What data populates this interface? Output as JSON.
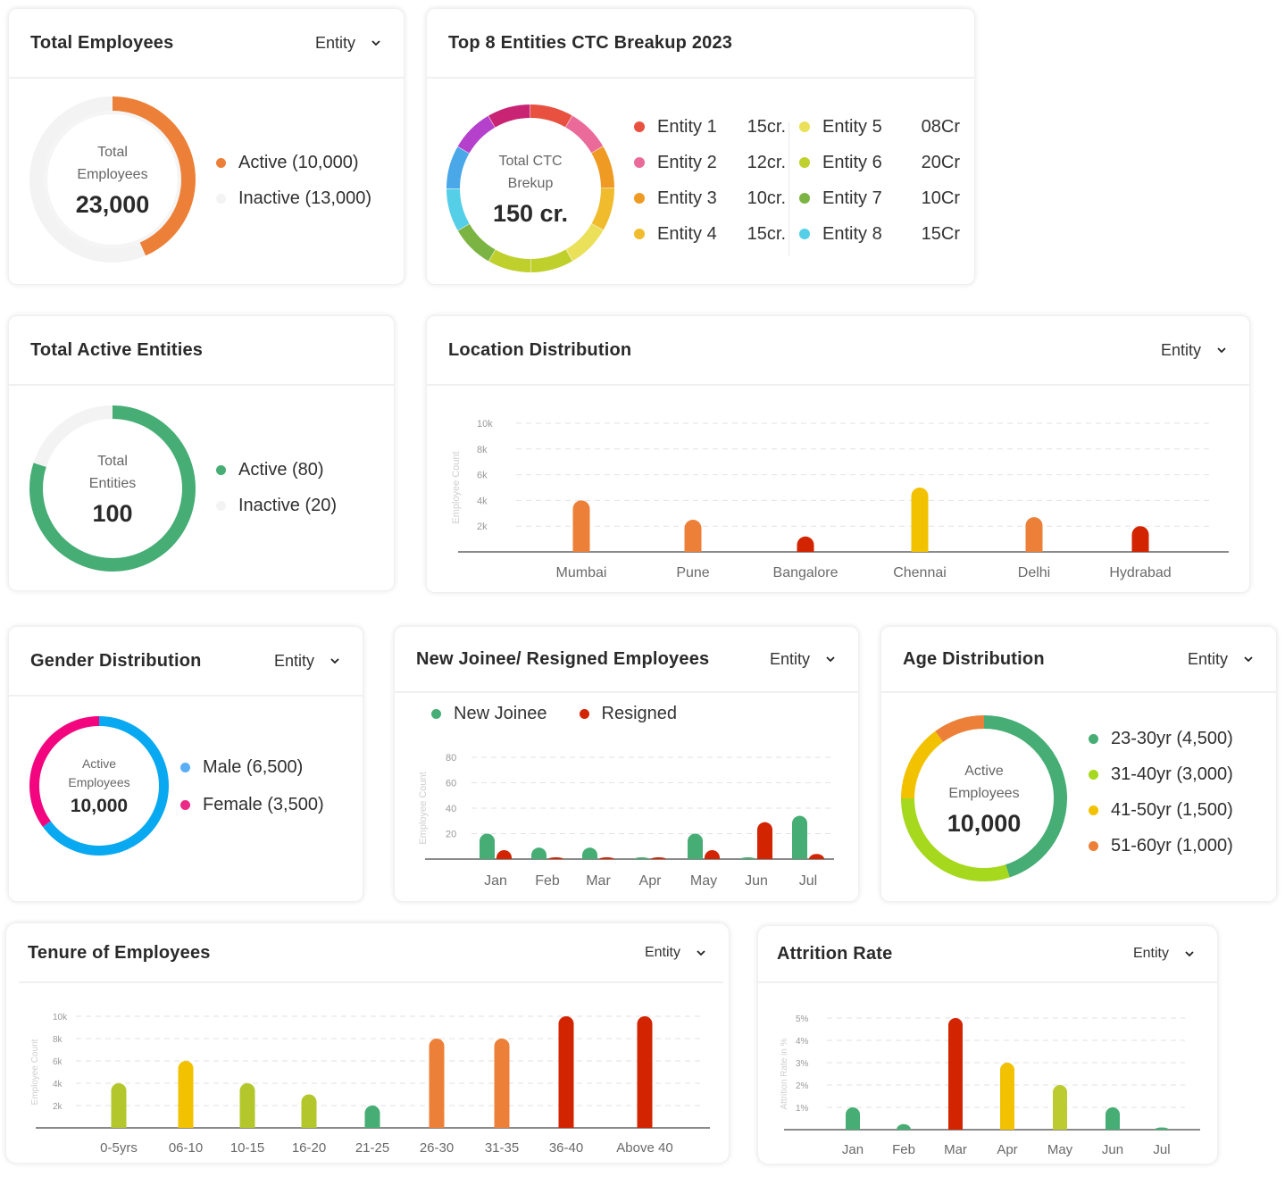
{
  "total_employees": {
    "title": "Total Employees",
    "filter": "Entity",
    "center_label_line1": "Total",
    "center_label_line2": "Employees",
    "center_value": "23,000",
    "legend": [
      {
        "label": "Active (10,000)",
        "color": "#ec8038"
      },
      {
        "label": "Inactive (13,000)",
        "color": "#f3f3f3"
      }
    ]
  },
  "ctc_breakup": {
    "title": "Top 8 Entities CTC Breakup 2023",
    "center_label_line1": "Total CTC",
    "center_label_line2": "Brekup",
    "center_value": "150 cr.",
    "entities": [
      {
        "name": "Entity 1",
        "value": "15cr.",
        "color": "#e8513f"
      },
      {
        "name": "Entity 2",
        "value": "12cr.",
        "color": "#ea6a9a"
      },
      {
        "name": "Entity 3",
        "value": "10cr.",
        "color": "#ee9a23"
      },
      {
        "name": "Entity 4",
        "value": "15cr.",
        "color": "#f0bc2e"
      },
      {
        "name": "Entity 5",
        "value": "08Cr",
        "color": "#ebe05a"
      },
      {
        "name": "Entity 6",
        "value": "20Cr",
        "color": "#bfd02c"
      },
      {
        "name": "Entity 7",
        "value": "10Cr",
        "color": "#7cb443"
      },
      {
        "name": "Entity 8",
        "value": "15Cr",
        "color": "#55cee8"
      }
    ],
    "ring_colors": [
      "#e8513f",
      "#ea6a9a",
      "#ee9a23",
      "#f0bc2e",
      "#ebe05a",
      "#bfd02c",
      "#bfd02c",
      "#7cb443",
      "#55cee8",
      "#4aa7e8",
      "#b440cc",
      "#c92474"
    ]
  },
  "active_entities": {
    "title": "Total Active Entities",
    "center_label_line1": "Total",
    "center_label_line2": "Entities",
    "center_value": "100",
    "legend": [
      {
        "label": "Active (80)",
        "color": "#46ad74"
      },
      {
        "label": "Inactive (20)",
        "color": "#f3f3f3"
      }
    ]
  },
  "location": {
    "title": "Location Distribution",
    "filter": "Entity"
  },
  "gender": {
    "title": "Gender Distribution",
    "filter": "Entity",
    "center_label_line1": "Active",
    "center_label_line2": "Employees",
    "center_value": "10,000",
    "legend": [
      {
        "label": "Male (6,500)",
        "color": "#5aaef5"
      },
      {
        "label": "Female (3,500)",
        "color": "#ec2a86"
      }
    ]
  },
  "joinee": {
    "title": "New Joinee/ Resigned Employees",
    "filter": "Entity",
    "legend": [
      {
        "label": "New Joinee",
        "color": "#46ad74"
      },
      {
        "label": "Resigned",
        "color": "#d22400"
      }
    ]
  },
  "age": {
    "title": "Age Distribution",
    "filter": "Entity",
    "center_label_line1": "Active",
    "center_label_line2": "Employees",
    "center_value": "10,000",
    "legend": [
      {
        "label": "23-30yr (4,500)",
        "color": "#46ad74"
      },
      {
        "label": "31-40yr (3,000)",
        "color": "#a6d81e"
      },
      {
        "label": "41-50yr (1,500)",
        "color": "#f2c200"
      },
      {
        "label": "51-60yr (1,000)",
        "color": "#ec8038"
      }
    ]
  },
  "tenure": {
    "title": "Tenure of Employees",
    "filter": "Entity"
  },
  "attrition": {
    "title": "Attrition Rate",
    "filter": "Entity"
  },
  "chart_data": [
    {
      "id": "total_employees",
      "type": "pie",
      "title": "Total Employees",
      "categories": [
        "Active",
        "Inactive"
      ],
      "values": [
        10000,
        13000
      ],
      "colors": [
        "#ec8038",
        "#f3f3f3"
      ]
    },
    {
      "id": "ctc_breakup",
      "type": "pie",
      "title": "Top 8 Entities CTC Breakup 2023",
      "categories": [
        "Entity 1",
        "Entity 2",
        "Entity 3",
        "Entity 4",
        "Entity 5",
        "Entity 6",
        "Entity 7",
        "Entity 8"
      ],
      "values": [
        15,
        12,
        10,
        15,
        8,
        20,
        10,
        15
      ],
      "unit": "cr"
    },
    {
      "id": "active_entities",
      "type": "pie",
      "title": "Total Active Entities",
      "categories": [
        "Active",
        "Inactive"
      ],
      "values": [
        80,
        20
      ],
      "colors": [
        "#46ad74",
        "#f3f3f3"
      ]
    },
    {
      "id": "location",
      "type": "bar",
      "title": "Location Distribution",
      "xlabel": "",
      "ylabel": "Employee Count",
      "categories": [
        "Mumbai",
        "Pune",
        "Bangalore",
        "Chennai",
        "Delhi",
        "Hydrabad"
      ],
      "values": [
        4000,
        2500,
        1200,
        5000,
        2700,
        2000
      ],
      "colors": [
        "#ec8038",
        "#ec8038",
        "#d22400",
        "#f2c200",
        "#ec8038",
        "#d22400"
      ],
      "yticks": [
        2000,
        4000,
        6000,
        8000,
        10000
      ],
      "ytick_labels": [
        "2k",
        "4k",
        "6k",
        "8k",
        "10k"
      ],
      "ylim": [
        0,
        10000
      ],
      "grid": true
    },
    {
      "id": "gender",
      "type": "pie",
      "title": "Gender Distribution",
      "categories": [
        "Male",
        "Female"
      ],
      "values": [
        6500,
        3500
      ],
      "colors": [
        "#08a9f0",
        "#f3057f"
      ]
    },
    {
      "id": "joinee",
      "type": "bar",
      "title": "New Joinee/ Resigned Employees",
      "ylabel": "Employee Count",
      "categories": [
        "Jan",
        "Feb",
        "Mar",
        "Apr",
        "May",
        "Jun",
        "Jul"
      ],
      "series": [
        {
          "name": "New Joinee",
          "values": [
            20,
            9,
            9,
            1,
            20,
            1,
            34
          ],
          "color": "#46ad74"
        },
        {
          "name": "Resigned",
          "values": [
            7,
            1,
            1,
            1,
            7,
            29,
            4
          ],
          "color": "#d22400"
        }
      ],
      "yticks": [
        20,
        40,
        60,
        80
      ],
      "ytick_labels": [
        "20",
        "40",
        "60",
        "80"
      ],
      "ylim": [
        0,
        80
      ],
      "legend": "top-left",
      "grid": true
    },
    {
      "id": "age",
      "type": "pie",
      "title": "Age Distribution",
      "categories": [
        "23-30yr",
        "31-40yr",
        "41-50yr",
        "51-60yr"
      ],
      "values": [
        4500,
        3000,
        1500,
        1000
      ],
      "colors": [
        "#46ad74",
        "#a6d81e",
        "#f2c200",
        "#ec8038"
      ]
    },
    {
      "id": "tenure",
      "type": "bar",
      "title": "Tenure of Employees",
      "ylabel": "Employee Count",
      "categories": [
        "0-5yrs",
        "06-10",
        "10-15",
        "16-20",
        "21-25",
        "26-30",
        "31-35",
        "36-40",
        "Above 40"
      ],
      "values": [
        4000,
        6000,
        4000,
        3000,
        2000,
        8000,
        8000,
        10000,
        10000
      ],
      "colors": [
        "#b3c72c",
        "#f2c200",
        "#b3c72c",
        "#b3c72c",
        "#46ad74",
        "#ec8038",
        "#ec8038",
        "#d22400",
        "#d22400"
      ],
      "yticks": [
        2000,
        4000,
        6000,
        8000,
        10000
      ],
      "ytick_labels": [
        "2k",
        "4k",
        "6k",
        "8k",
        "10k"
      ],
      "ylim": [
        0,
        10000
      ],
      "grid": true
    },
    {
      "id": "attrition",
      "type": "bar",
      "title": "Attrition Rate",
      "ylabel": "Attrition Rate in %",
      "categories": [
        "Jan",
        "Feb",
        "Mar",
        "Apr",
        "May",
        "Jun",
        "Jul"
      ],
      "values": [
        1,
        0.25,
        5,
        3,
        2,
        1,
        0.1
      ],
      "colors": [
        "#46ad74",
        "#46ad74",
        "#d22400",
        "#f2c200",
        "#bccb30",
        "#46ad74",
        "#46ad74"
      ],
      "yticks": [
        1,
        2,
        3,
        4,
        5
      ],
      "ytick_labels": [
        "1%",
        "2%",
        "3%",
        "4%",
        "5%"
      ],
      "ylim": [
        0,
        5
      ],
      "grid": true
    }
  ]
}
